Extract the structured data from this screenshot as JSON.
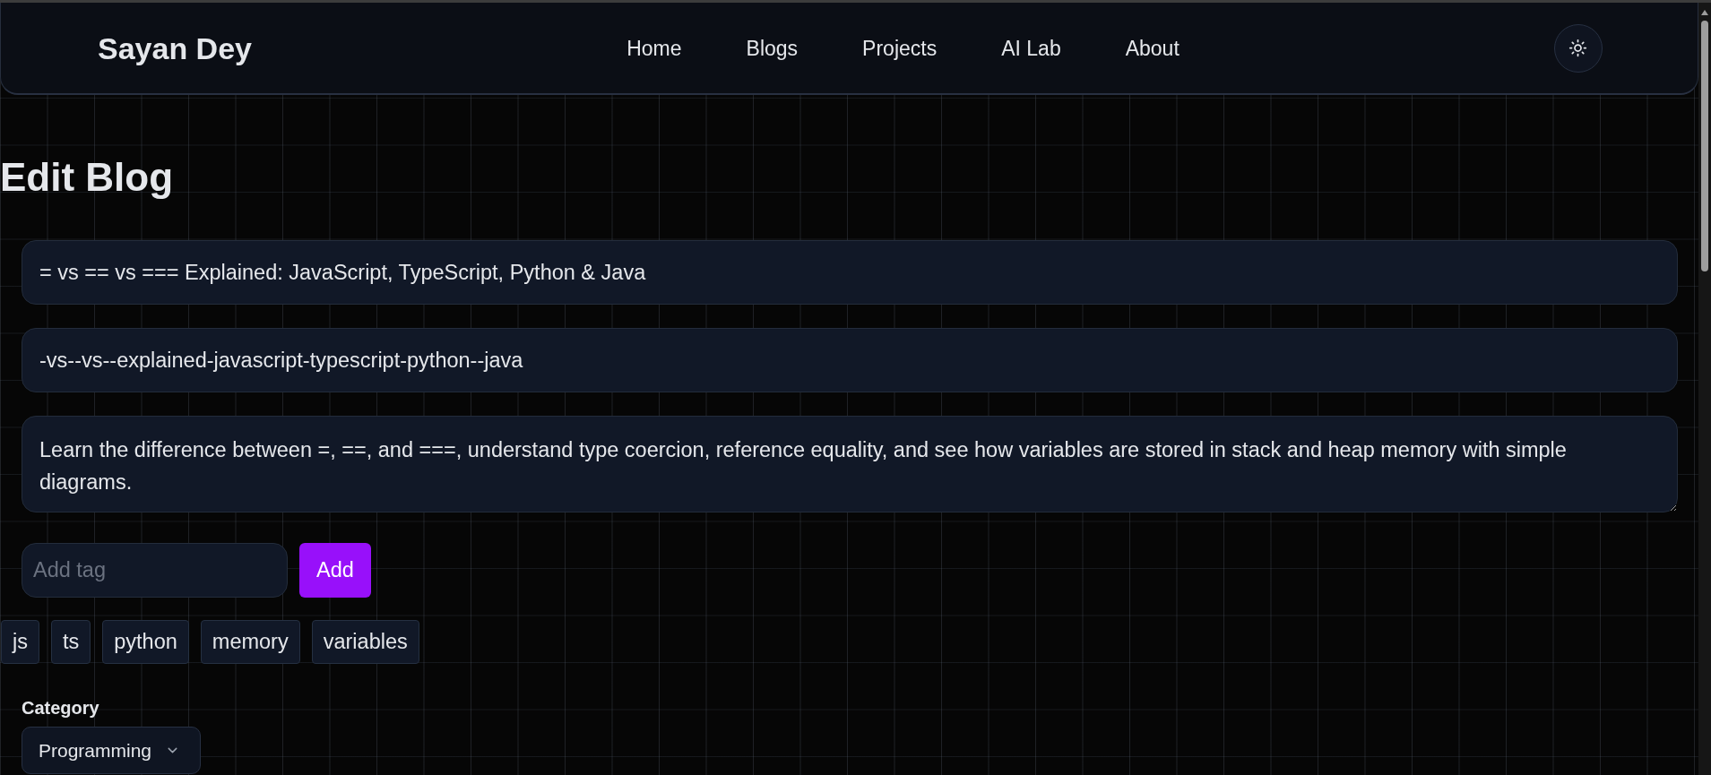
{
  "navbar": {
    "brand": "Sayan Dey",
    "links": [
      "Home",
      "Blogs",
      "Projects",
      "AI Lab",
      "About"
    ]
  },
  "page": {
    "heading": "Edit Blog"
  },
  "form": {
    "title": {
      "value": "= vs == vs === Explained: JavaScript, TypeScript, Python & Java"
    },
    "slug": {
      "value": "-vs--vs--explained-javascript-typescript-python--java"
    },
    "excerpt": {
      "value": "Learn the difference between =, ==, and ===, understand type coercion, reference equality, and see how variables are stored in stack and heap memory with simple diagrams."
    },
    "tag_entry": {
      "placeholder": "Add tag",
      "button": "Add"
    },
    "tags": [
      "js",
      "ts",
      "python",
      "memory",
      "variables"
    ],
    "category": {
      "label": "Category",
      "value": "Programming"
    }
  }
}
